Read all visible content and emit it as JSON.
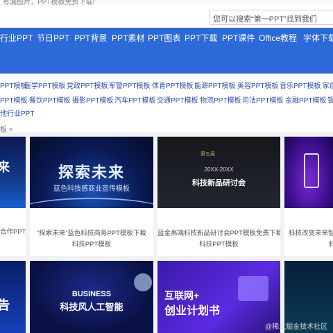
{
  "top_strip_text": "有漏图片，PPT模板免费下载!",
  "search": {
    "placeholder": "您可以搜索“第一PPT”找到我们"
  },
  "nav": {
    "items": [
      "行业PPT",
      "节日PPT",
      "PPT背景",
      "PPT素材",
      "PPT图表",
      "PPT下载",
      "PPT课件",
      "Office教程",
      "字体下载"
    ]
  },
  "categories": {
    "row1": [
      "PPT模板",
      "医学PPT模板",
      "党政PPT模板",
      "军警PPT模板",
      "体育PPT模板",
      "能源PPT模板",
      "美容PPT模板",
      "音乐PPT模板",
      "家居"
    ],
    "row2": [
      "PPT模板",
      "餐饮PPT模板",
      "摄影PPT模板",
      "汽车PPT模板",
      "交通PPT模板",
      "物流PPT模板",
      "司法PPT模板",
      "金融PPT模板",
      "银"
    ],
    "row3": [
      "他行业PPT"
    ]
  },
  "breadcrumb": "板 >",
  "cards": [
    {
      "title1": "合作PPT模",
      "title2": "",
      "thumb_text": "来"
    },
    {
      "title1": "“探索未来”蓝色科技商务PPT模板下载",
      "title2": "科技PPT模板",
      "thumb_text": "探索未来",
      "thumb_sub": "蓝色科技感商业宣传模板"
    },
    {
      "title1": "蓝金高端科技新品研讨会PPT模板免费下载",
      "title2": "科技PPT模板",
      "thumb_text": "20XX-20XX",
      "thumb_sub": "科技新品研讨会",
      "thumb_tag": "第五届"
    },
    {
      "title1": "科技改变未来智慧会",
      "title2": "科",
      "thumb_text": ""
    },
    {
      "thumb_text": "告"
    },
    {
      "thumb_text": "BUSINESS",
      "thumb_sub": "科技风人工智能"
    },
    {
      "thumb_text": "互联网+",
      "thumb_sub": "创业计划书"
    },
    {
      "thumb_text": ""
    }
  ],
  "watermark": "@稀土掘金技术社区",
  "colors": {
    "nav_bg": "#2d6ad8",
    "link": "#2a4fa8"
  }
}
